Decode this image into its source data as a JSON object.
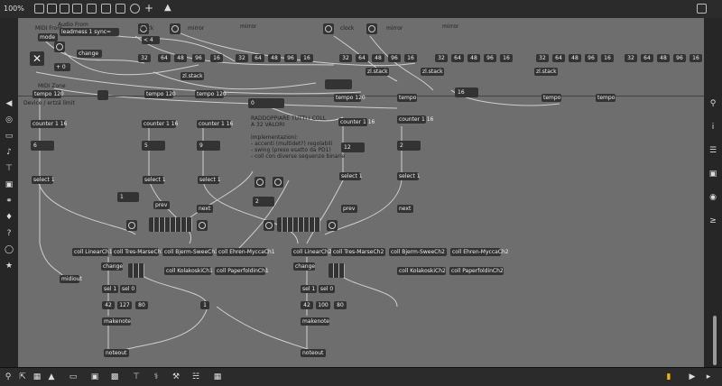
{
  "toolbar": {
    "zoom": "100%"
  },
  "canvas": {
    "header_comments": [
      "MIDI From",
      "Audio From",
      "Device / ertzä limit",
      "MIDI Zone"
    ],
    "clock_labels": [
      "clock",
      "mirror",
      "mirror",
      "clock",
      "mirror",
      "mirror"
    ],
    "msgs": {
      "mode": "mode",
      "leadmess": "leadmess 1 sync=",
      "change": "change",
      "change2": "change",
      "change3": "change",
      "vel": "< 4",
      "s0": "+ 0"
    },
    "nums_row": [
      "32",
      "64",
      "48",
      "96",
      "16",
      "32",
      "64",
      "48",
      "96",
      "16",
      "32",
      "64",
      "48",
      "96",
      "16",
      "32",
      "64",
      "48",
      "96",
      "16",
      "32",
      "64",
      "48",
      "96",
      "16"
    ],
    "stack": [
      "zl.stack",
      "zl.stack",
      "zl.stack",
      "zl.stack"
    ],
    "tempos": [
      "tempo 120",
      "tempo 120",
      "tempo 120",
      "tempo 120",
      "tempo",
      "tempo",
      "tempo"
    ],
    "counters": [
      "counter 1 16",
      "counter 1 16",
      "counter 1 16",
      "counter 1 16",
      "counter 1 16"
    ],
    "ns": [
      "6",
      "5",
      "9",
      "12",
      "16",
      "2",
      "2",
      "1",
      "16"
    ],
    "select": [
      "select 1",
      "select 1",
      "select 1",
      "select 1",
      "select 1"
    ],
    "prevnext": [
      "prev",
      "next",
      "prev",
      "next"
    ],
    "colls": [
      "coll LinearCh1",
      "coll Tres-MarseCh1",
      "coll Bjerm-SweeCh1",
      "coll Ehren-MyccaCh1",
      "coll LinearCh2",
      "coll Tres-MarseCh2",
      "coll Bjerm-SweeCh2",
      "coll Ehren-MyccaCh2",
      "coll KolakoskiCh1",
      "coll PaperfoldinCh1",
      "coll KolakoskiCh2",
      "coll PaperfoldinCh2"
    ],
    "sel": [
      "sel 1",
      "sel 0",
      "sel 1",
      "sel 0"
    ],
    "notes": [
      "42",
      "127",
      "80",
      "42",
      "100",
      "80"
    ],
    "makenote": [
      "makenote",
      "makenote"
    ],
    "noteout": [
      "noteout",
      "noteout",
      "midiout"
    ],
    "comment": "RADDOPPIARE TUTTI I COLL\nA 32 VALORI\n\nimplementazioni:\n- accenti (multidet?) regolabili\n- swing (preso esatto da PD1)\n- coll con diverse sequenze binarie",
    "extras": {
      "n0": "0",
      "n16": "16"
    }
  }
}
